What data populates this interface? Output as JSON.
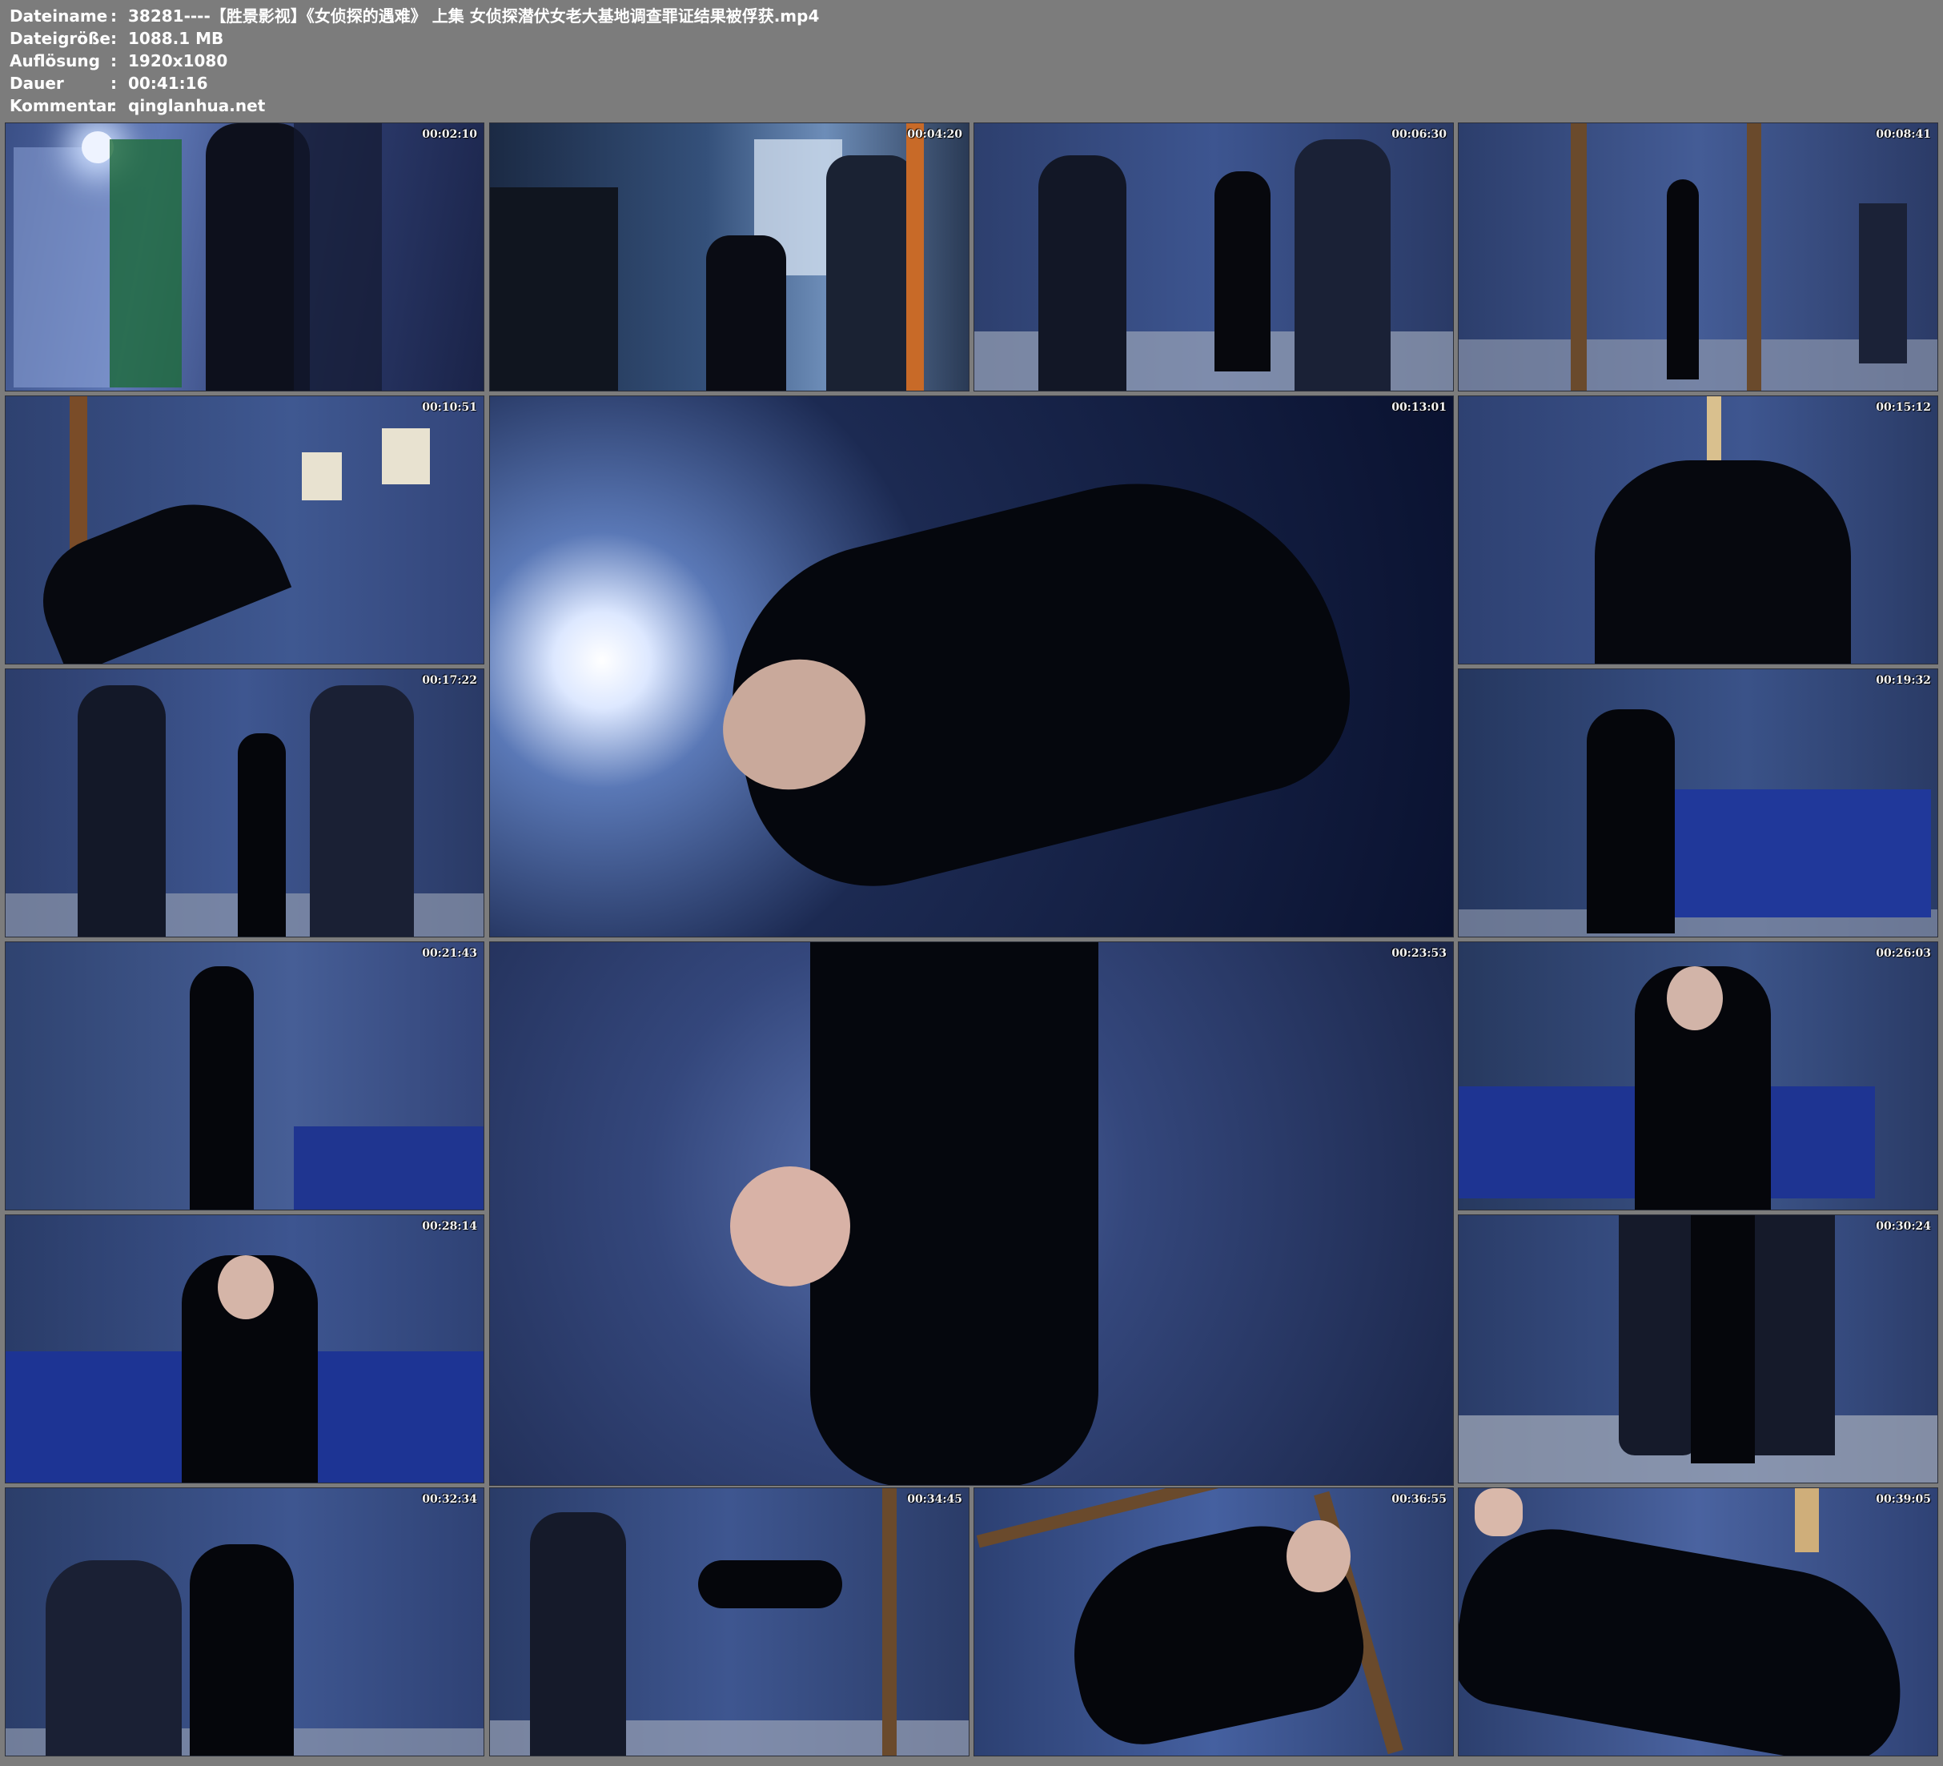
{
  "meta": [
    {
      "key": "Dateiname",
      "value": "38281----【胜景影视】《女侦探的遇难》 上集 女侦探潜伏女老大基地调查罪证结果被俘获.mp4"
    },
    {
      "key": "Dateigröße",
      "value": "1088.1 MB"
    },
    {
      "key": "Auflösung",
      "value": "1920x1080"
    },
    {
      "key": "Dauer",
      "value": "00:41:16"
    },
    {
      "key": "Kommentar",
      "value": "qinglanhua.net"
    }
  ],
  "separator": ":",
  "thumbnails": [
    {
      "time": "00:02:10"
    },
    {
      "time": "00:04:20"
    },
    {
      "time": "00:06:30"
    },
    {
      "time": "00:08:41"
    },
    {
      "time": "00:10:51"
    },
    {
      "time": "00:13:01"
    },
    {
      "time": "00:15:12"
    },
    {
      "time": "00:17:22"
    },
    {
      "time": "00:19:32"
    },
    {
      "time": "00:21:43"
    },
    {
      "time": "00:23:53"
    },
    {
      "time": "00:26:03"
    },
    {
      "time": "00:28:14"
    },
    {
      "time": "00:30:24"
    },
    {
      "time": "00:32:34"
    },
    {
      "time": "00:34:45"
    },
    {
      "time": "00:36:55"
    },
    {
      "time": "00:39:05"
    }
  ]
}
